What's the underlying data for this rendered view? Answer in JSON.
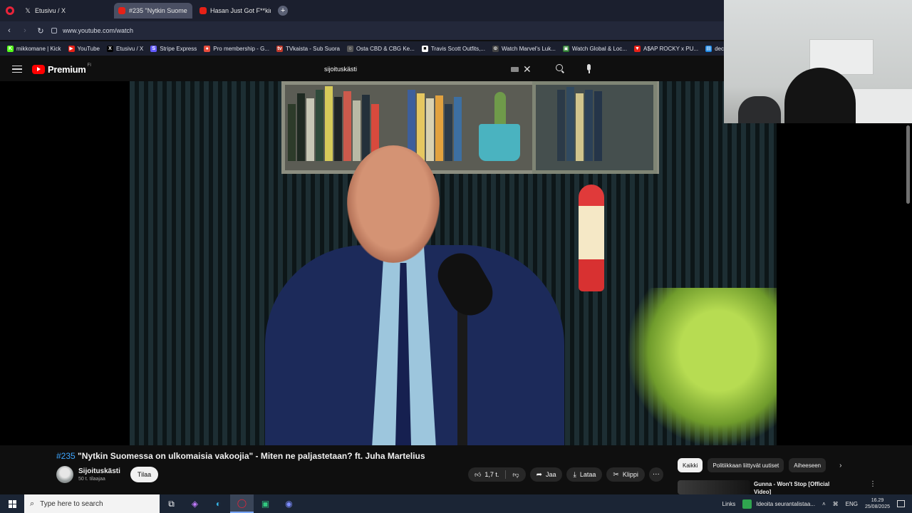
{
  "browser": {
    "tabs": [
      {
        "label": "Etusivu / X",
        "icon": "x-logo-icon"
      },
      {
        "label": "#235 \"Nytkin Suome",
        "icon": "youtube-icon",
        "active": true
      },
      {
        "label": "Hasan Just Got F**king Ob",
        "icon": "youtube-icon"
      }
    ],
    "url": "www.youtube.com/watch",
    "bookmarks": [
      {
        "label": "mikkomane | Kick",
        "color": "#53fc18",
        "glyph": "K"
      },
      {
        "label": "YouTube",
        "color": "#e62117",
        "glyph": "▶"
      },
      {
        "label": "Etusivu / X",
        "color": "#000000",
        "glyph": "X"
      },
      {
        "label": "Stripe Express",
        "color": "#635bff",
        "glyph": "S"
      },
      {
        "label": "Pro membership - G...",
        "color": "#e74c3c",
        "glyph": "●"
      },
      {
        "label": "TVkaista - Sub Suora",
        "color": "#c0392b",
        "glyph": "tv"
      },
      {
        "label": "Osta CBD & CBG Ke...",
        "color": "#555555",
        "glyph": "○"
      },
      {
        "label": "Travis Scott Outfits,...",
        "color": "#ffffff",
        "glyph": "■"
      },
      {
        "label": "Watch Marvel's Luk...",
        "color": "#444444",
        "glyph": "⊙"
      },
      {
        "label": "Watch Global & Loc...",
        "color": "#2e7d32",
        "glyph": "▣"
      },
      {
        "label": "A$AP ROCKY x PU...",
        "color": "#e62117",
        "glyph": "▼"
      },
      {
        "label": "deceive",
        "color": "#1e88e5",
        "glyph": "▤"
      }
    ]
  },
  "youtube": {
    "logo_text": "Premium",
    "country_code": "FI",
    "search_value": "sijoituskästi"
  },
  "video": {
    "episode_tag": "#235",
    "title": "\"Nytkin Suomessa on ulkomaisia vakoojia\" - Miten ne paljastetaan? ft. Juha Martelius",
    "channel_name": "Sijoituskästi",
    "subscribers": "50 t. tilaajaa",
    "subscribe_label": "Tilaa",
    "likes": "1,7 t.",
    "share_label": "Jaa",
    "download_label": "Lataa",
    "clip_label": "Klippi",
    "more_label": "···"
  },
  "sidebar": {
    "chips": [
      "Kaikki",
      "Politiikkaan liittyvät uutiset",
      "Aiheeseen"
    ],
    "recommendation": {
      "title": "Gunna - Won't Stop [Official Video]"
    }
  },
  "taskbar": {
    "search_placeholder": "Type here to search",
    "links_label": "Links",
    "news_text": "Ideoita seurantalistaa...",
    "language": "ENG",
    "time": "16.29",
    "date": "25/08/2025"
  }
}
